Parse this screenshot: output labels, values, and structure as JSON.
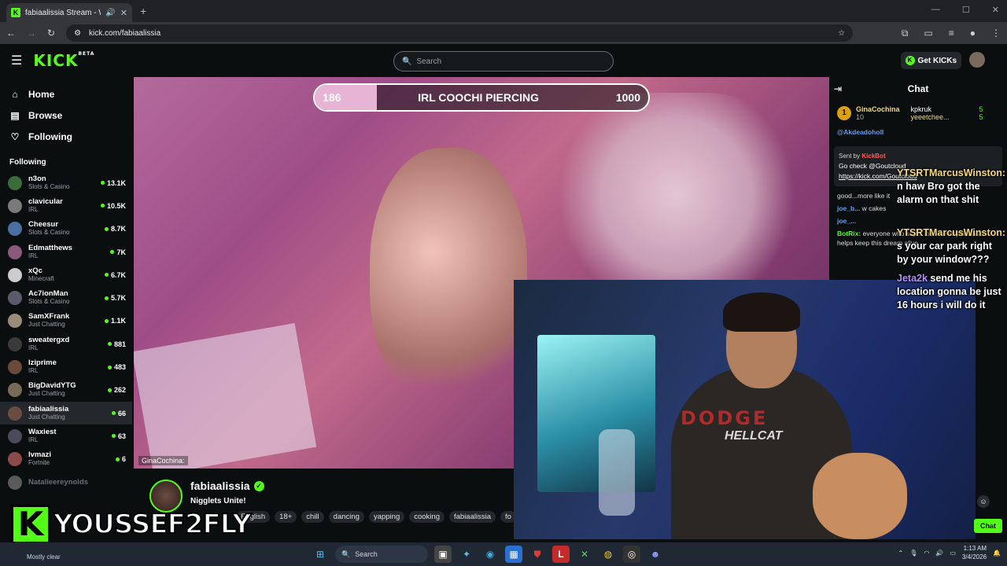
{
  "browser": {
    "tab_title": "fabiaalissia Stream - Watch",
    "url": "kick.com/fabiaalissia"
  },
  "kick": {
    "logo": "KICK",
    "logo_beta": "BETA",
    "search_placeholder": "Search",
    "get_kicks": "Get KICKs"
  },
  "sidebar": {
    "nav": [
      {
        "label": "Home",
        "icon": "home-icon"
      },
      {
        "label": "Browse",
        "icon": "browse-icon"
      },
      {
        "label": "Following",
        "icon": "heart-icon"
      }
    ],
    "following_title": "Following",
    "following": [
      {
        "name": "n3on",
        "category": "Slots & Casino",
        "viewers": "13.1K",
        "color": "#3a6b3a"
      },
      {
        "name": "clavicular",
        "category": "IRL",
        "viewers": "10.5K",
        "color": "#7a7a7a"
      },
      {
        "name": "Cheesur",
        "category": "Slots & Casino",
        "viewers": "8.7K",
        "color": "#4a6ea0"
      },
      {
        "name": "Edmatthews",
        "category": "IRL",
        "viewers": "7K",
        "color": "#8a5a7a"
      },
      {
        "name": "xQc",
        "category": "Minecraft",
        "viewers": "6.7K",
        "color": "#cccccc"
      },
      {
        "name": "Ac7ionMan",
        "category": "Slots & Casino",
        "viewers": "5.7K",
        "color": "#5a5a6a"
      },
      {
        "name": "SamXFrank",
        "category": "Just Chatting",
        "viewers": "1.1K",
        "color": "#9a8a7a"
      },
      {
        "name": "sweatergxd",
        "category": "IRL",
        "viewers": "881",
        "color": "#3a3a3a"
      },
      {
        "name": "lziprime",
        "category": "IRL",
        "viewers": "483",
        "color": "#6a4a3a"
      },
      {
        "name": "BigDavidYTG",
        "category": "Just Chatting",
        "viewers": "262",
        "color": "#7a6a5a"
      },
      {
        "name": "fabiaalissia",
        "category": "Just Chatting",
        "viewers": "66",
        "color": "#6b4c42"
      },
      {
        "name": "Waxiest",
        "category": "IRL",
        "viewers": "63",
        "color": "#4a4a5a"
      },
      {
        "name": "lvmazi",
        "category": "Fortnite",
        "viewers": "6",
        "color": "#8a4a4a"
      },
      {
        "name": "Natalieereynolds",
        "category": "",
        "viewers": "",
        "color": "#5a5a5a"
      }
    ]
  },
  "stream": {
    "goal_left": "186",
    "goal_title": "IRL COOCHI PIERCING",
    "goal_right": "1000",
    "goal_progress": 0.186,
    "overlay_user": "GinaCochina:"
  },
  "cam": {
    "shirt_text": "DODGE",
    "shirt_text2": "HELLCAT"
  },
  "channel": {
    "name": "fabiaalissia",
    "title": "Nigglets Unite!",
    "tags": [
      "English",
      "18+",
      "chill",
      "dancing",
      "yapping",
      "cooking",
      "fabiaalissia",
      "fo"
    ]
  },
  "chat": {
    "header": "Chat",
    "top_gifter": {
      "name": "GinaCochina",
      "count": "10"
    },
    "gifters": [
      {
        "name": "kpkruk",
        "count": "5"
      },
      {
        "name": "yeeetchee...",
        "count": "5"
      }
    ],
    "pinned_by": "Sent by",
    "pinned_user": "KickBot",
    "pinned_text": "Go check @Goutcloud",
    "pinned_link": "https://kick.com/Goutcloud",
    "messages": [
      {
        "user": "@Akdeadoholl",
        "text": ""
      },
      {
        "user": "",
        "text": "good...more like it"
      },
      {
        "user": "joe_b...",
        "text": "w cakes"
      },
      {
        "user": "joe_...",
        "text": ""
      },
      {
        "user": "BotRix:",
        "text": "everyone who sup... love • every donation helps keep this dream alive"
      }
    ],
    "overlay_msgs": [
      {
        "name": "YTSRTMarcusWinston:",
        "text": "n haw Bro got the alarm on that shit"
      },
      {
        "name": "YTSRTMarcusWinston:",
        "text": "s your car park right by your window???"
      },
      {
        "name": "Jeta2k",
        "text": "send me his location gonna be just 16 hours i will do it"
      }
    ],
    "chat_button": "Chat"
  },
  "watermark": {
    "letter": "K",
    "name": "YOUSSEF2FLY"
  },
  "taskbar": {
    "weather": "Mostly clear",
    "search": "Search",
    "time": "1:13 AM",
    "date": "3/4/2026"
  }
}
